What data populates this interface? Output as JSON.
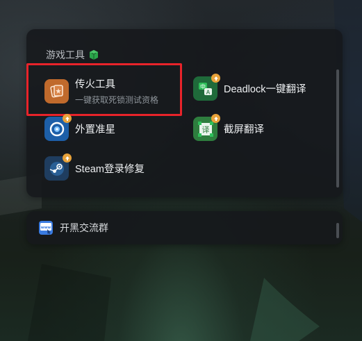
{
  "section": {
    "title": "游戏工具",
    "icon": "cube-icon"
  },
  "tools": [
    {
      "name": "传火工具",
      "sub": "一键获取死锁测试资格",
      "icon": "card-icon",
      "color": "#c06a2c",
      "highlighted": true
    },
    {
      "name": "Deadlock一键翻译",
      "icon": "translate-zh-a-icon",
      "color": "#1f6a3a",
      "badge": "upload-icon"
    },
    {
      "name": "外置准星",
      "icon": "crosshair-icon",
      "color": "#1d5fa8",
      "badge": "upload-icon"
    },
    {
      "name": "截屏翻译",
      "icon": "screenshot-translate-icon",
      "color": "#2e7d3e",
      "badge": "upload-icon"
    },
    {
      "name": "Steam登录修复",
      "icon": "steam-icon",
      "color": "#1f3d5f",
      "badge": "upload-icon"
    }
  ],
  "group": {
    "label": "开黑交流群",
    "icon": "www-icon"
  },
  "colors": {
    "highlight": "#e8232a",
    "badge": "#e8a23a",
    "accent_green": "#2aa54a"
  }
}
